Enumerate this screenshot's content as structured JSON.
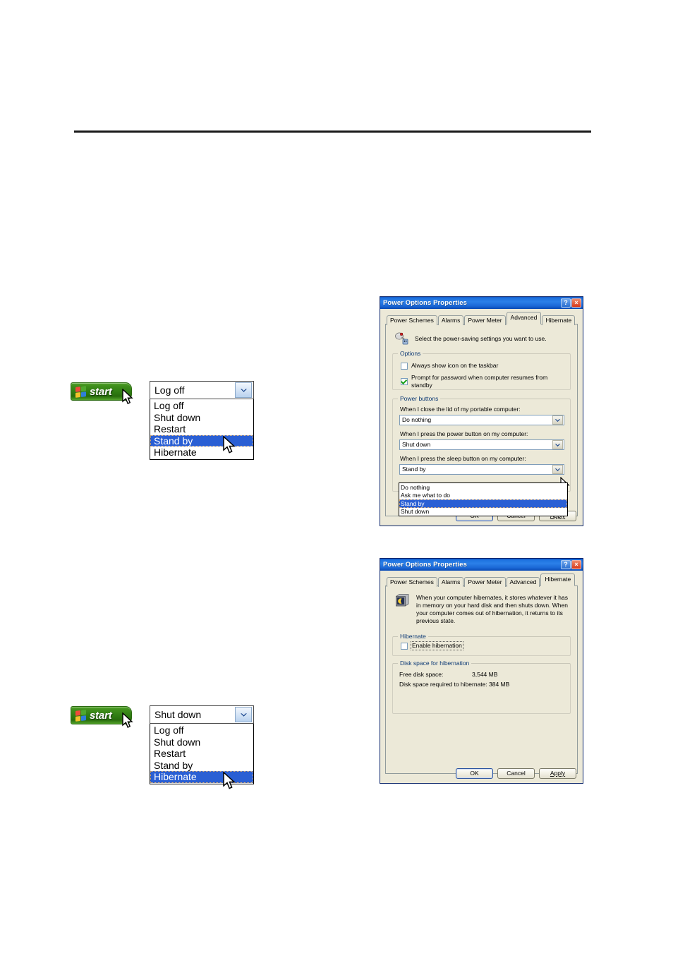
{
  "page": {
    "background": "#ffffff",
    "rule_color": "#1a1a1a"
  },
  "start_widget_top": {
    "start_label": "start",
    "combo": {
      "selected": "Log off",
      "options": [
        "Log off",
        "Shut down",
        "Restart",
        "Stand by",
        "Hibernate"
      ],
      "highlighted": "Stand by"
    }
  },
  "start_widget_bottom": {
    "start_label": "start",
    "combo": {
      "selected": "Shut down",
      "options": [
        "Log off",
        "Shut down",
        "Restart",
        "Stand by",
        "Hibernate"
      ],
      "highlighted": "Hibernate"
    }
  },
  "dialog_advanced": {
    "title": "Power Options Properties",
    "help_button": "?",
    "close_button": "×",
    "tabs": [
      {
        "label": "Power Schemes",
        "active": false
      },
      {
        "label": "Alarms",
        "active": false
      },
      {
        "label": "Power Meter",
        "active": false
      },
      {
        "label": "Advanced",
        "active": true
      },
      {
        "label": "Hibernate",
        "active": false
      }
    ],
    "header_text": "Select the power-saving settings you want to use.",
    "options_group": {
      "legend": "Options",
      "checkboxes": [
        {
          "label": "Always show icon on the taskbar",
          "checked": false
        },
        {
          "label": "Prompt for password when computer resumes from standby",
          "checked": true
        }
      ]
    },
    "power_buttons_group": {
      "legend": "Power buttons",
      "fields": [
        {
          "label": "When I close the lid of my portable computer:",
          "value": "Do nothing"
        },
        {
          "label": "When I press the power button on my computer:",
          "value": "Shut down"
        },
        {
          "label": "When I press the sleep button on my computer:",
          "value": "Stand by"
        }
      ],
      "open_dropdown": {
        "options": [
          "Do nothing",
          "Ask me what to do",
          "Stand by",
          "Shut down"
        ],
        "highlighted": "Stand by"
      }
    },
    "buttons": [
      {
        "label": "OK",
        "default": true
      },
      {
        "label": "Cancel",
        "default": false
      },
      {
        "label": "Apply",
        "default": false
      }
    ]
  },
  "dialog_hibernate": {
    "title": "Power Options Properties",
    "help_button": "?",
    "close_button": "×",
    "tabs": [
      {
        "label": "Power Schemes",
        "active": false
      },
      {
        "label": "Alarms",
        "active": false
      },
      {
        "label": "Power Meter",
        "active": false
      },
      {
        "label": "Advanced",
        "active": false
      },
      {
        "label": "Hibernate",
        "active": true
      }
    ],
    "header_text": "When your computer hibernates, it stores whatever it has in memory on your hard disk and then shuts down. When your computer comes out of hibernation, it returns to its previous state.",
    "hibernate_group": {
      "legend": "Hibernate",
      "checkbox": {
        "label": "Enable hibernation",
        "checked": false
      }
    },
    "disk_group": {
      "legend": "Disk space for hibernation",
      "rows": [
        {
          "key": "Free disk space:",
          "value": "3,544 MB"
        },
        {
          "key": "Disk space required to hibernate:",
          "value": "384 MB"
        }
      ]
    },
    "buttons": [
      {
        "label": "OK",
        "default": true
      },
      {
        "label": "Cancel",
        "default": false
      },
      {
        "label": "Apply",
        "default": false
      }
    ]
  },
  "colors": {
    "titlebar_blue": "#1f73e0",
    "dialog_face": "#ece9d8",
    "selection_blue": "#2a5fd4",
    "group_legend": "#0d3a75",
    "start_green": "#3f8e1c"
  }
}
